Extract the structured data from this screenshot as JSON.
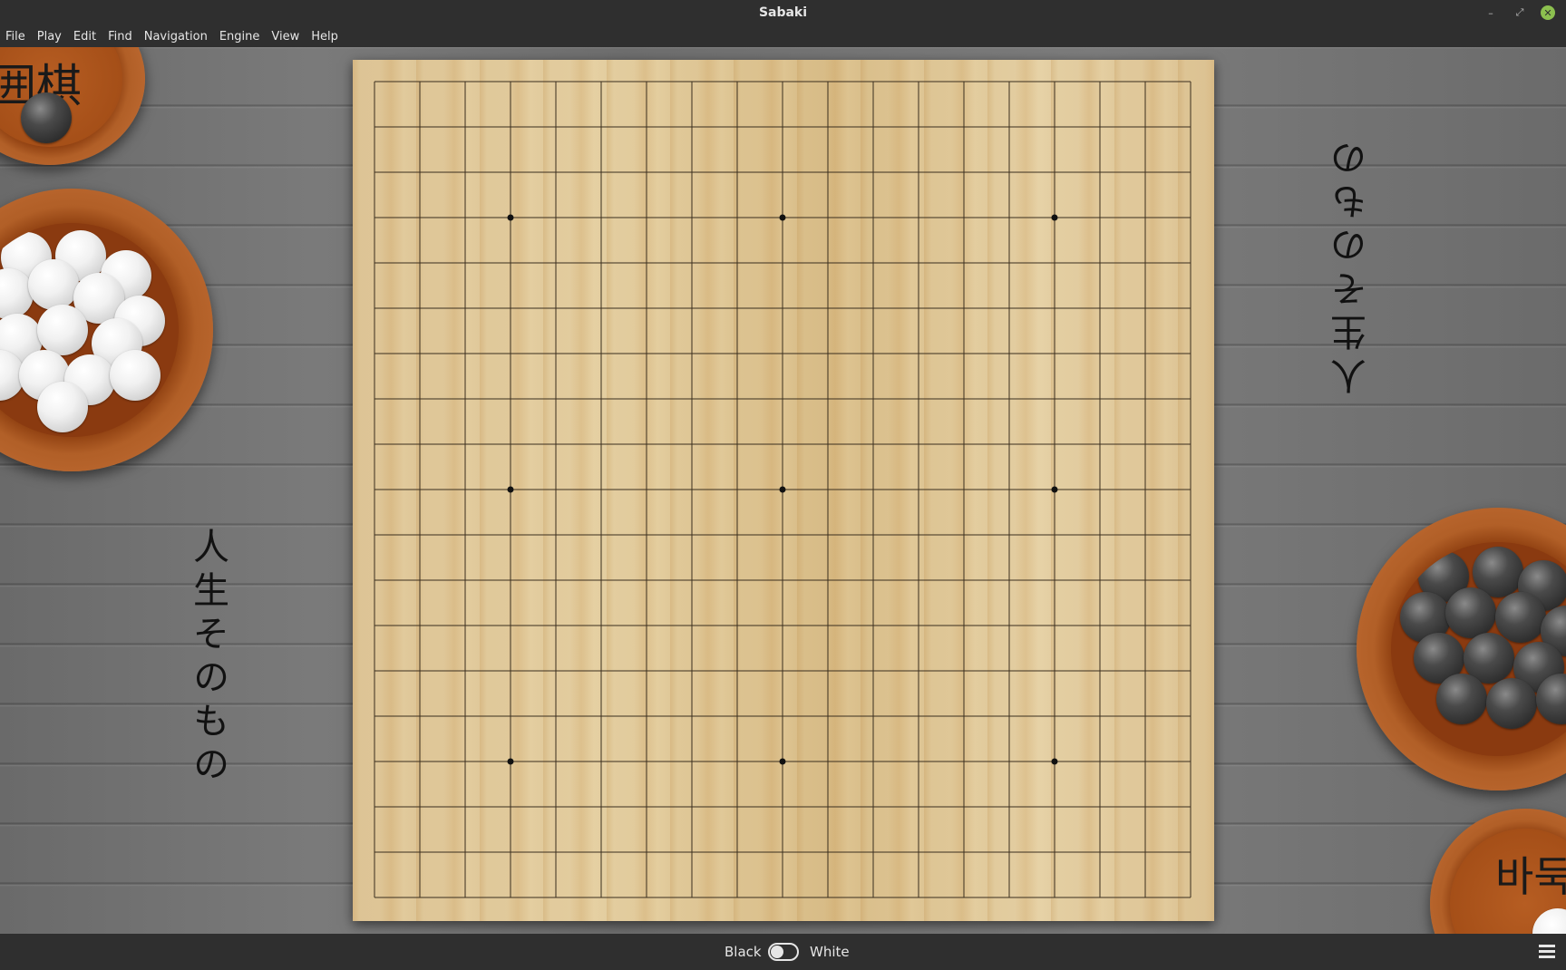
{
  "window": {
    "title": "Sabaki"
  },
  "menu": [
    "File",
    "Play",
    "Edit",
    "Find",
    "Navigation",
    "Engine",
    "View",
    "Help"
  ],
  "board": {
    "size": 19,
    "hoshi": [
      [
        3,
        3
      ],
      [
        3,
        9
      ],
      [
        3,
        15
      ],
      [
        9,
        3
      ],
      [
        9,
        9
      ],
      [
        9,
        15
      ],
      [
        15,
        3
      ],
      [
        15,
        9
      ],
      [
        15,
        15
      ]
    ]
  },
  "decor": {
    "lid_top_left": "囲棋",
    "lid_bottom_right": "바둑",
    "vertical_text_left": "人生そのもの",
    "vertical_text_right": "人生そのもの"
  },
  "statusbar": {
    "black_label": "Black",
    "white_label": "White",
    "toggle_state": "black"
  },
  "icons": {
    "minimize": "minimize-icon",
    "maximize": "maximize-icon",
    "close": "close-icon",
    "menu": "hamburger-menu-icon"
  },
  "colors": {
    "chrome": "#2f2f2f",
    "close_button": "#8cc04f"
  }
}
